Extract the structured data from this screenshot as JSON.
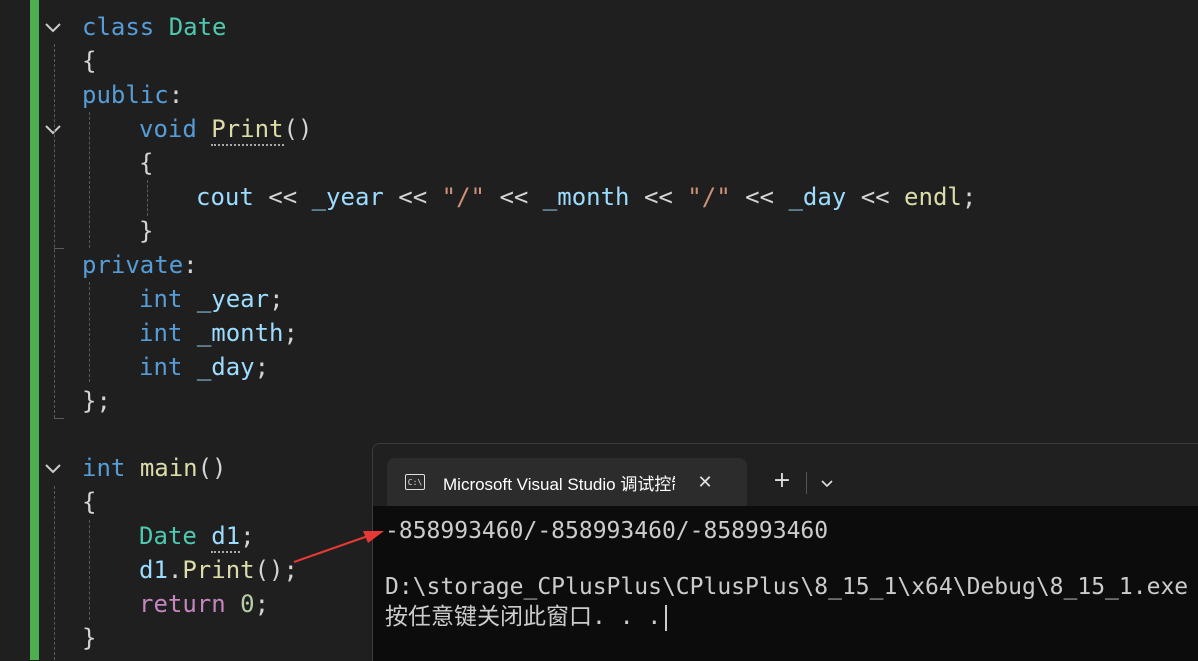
{
  "editor": {
    "code": {
      "class_kw": "class",
      "class_name": "Date",
      "brace_open": "{",
      "public_kw": "public",
      "colon": ":",
      "void_kw": "void",
      "print_fn": "Print",
      "parens": "()",
      "cout": "cout",
      "op1": " << ",
      "year": "_year",
      "slash1": "\"/\"",
      "month": "_month",
      "slash2": "\"/\"",
      "day": "_day",
      "endl": "endl",
      "semi": ";",
      "brace_close": "}",
      "private_kw": "private",
      "int_kw": "int",
      "class_end": "};",
      "main_fn": "main",
      "date_type": "Date",
      "d1": "d1",
      "dot": ".",
      "call_end": "();",
      "return_kw": "return",
      "zero": "0"
    },
    "change_bar_color": "#4caf50"
  },
  "terminal": {
    "tab_icon": "C:\\",
    "tab_title": "Microsoft Visual Studio 调试控制台",
    "close_icon": "close-icon",
    "new_tab_label": "+",
    "dropdown_icon": "chevron-down-icon",
    "output_line1": "-858993460/-858993460/-858993460",
    "output_line2": "D:\\storage_CPlusPlus\\CPlusPlus\\8_15_1\\x64\\Debug\\8_15_1.exe",
    "output_line3": "按任意键关闭此窗口. . ."
  },
  "annotation": {
    "arrow_color": "#e53935"
  }
}
